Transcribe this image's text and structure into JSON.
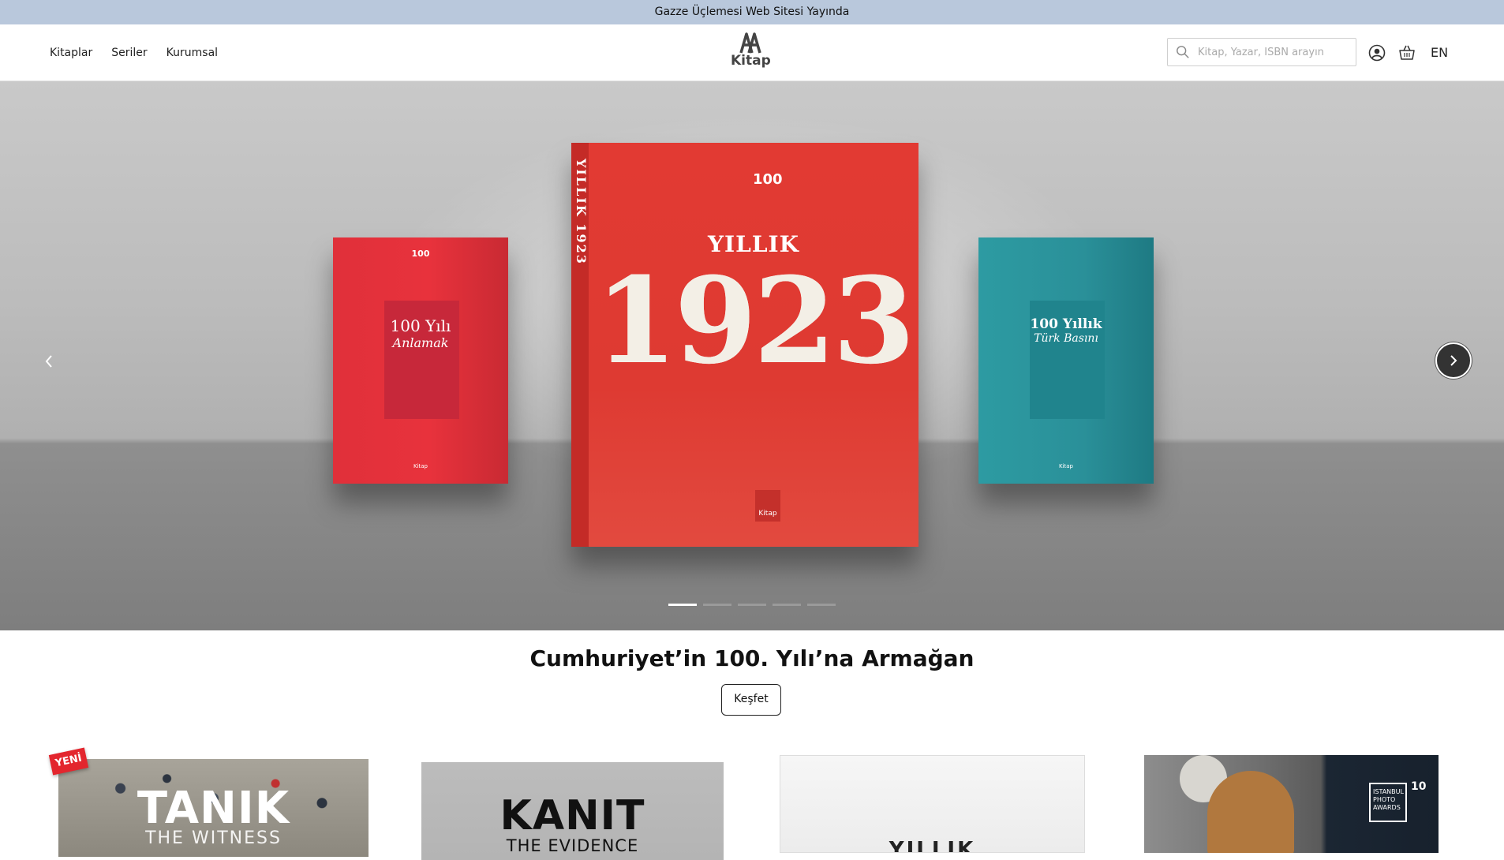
{
  "announcement": "Gazze Üçlemesi Web Sitesi Yayında",
  "nav": {
    "items": [
      "Kitaplar",
      "Seriler",
      "Kurumsal"
    ]
  },
  "logo": {
    "text": "Kitap"
  },
  "search": {
    "placeholder": "Kitap, Yazar, ISBN arayın"
  },
  "header": {
    "lang": "EN"
  },
  "hero": {
    "main_book": {
      "spine": "YILLIK 1923",
      "title": "YILLIK",
      "year": "1923",
      "badge": "100",
      "emblem": "Kitap"
    },
    "left_book": {
      "line1": "100 Yılı",
      "line2": "Anlamak",
      "badge": "100",
      "logo": "Kitap"
    },
    "right_book": {
      "line1": "100 Yıllık",
      "line2": "Türk Basını",
      "logo": "Kitap"
    },
    "slide_count": 5,
    "active_slide": 1
  },
  "feature": {
    "title": "Cumhuriyet’in 100. Yılı’na Armağan",
    "button": "Keşfet"
  },
  "cards": [
    {
      "badge": "YENİ",
      "title": "TANIK",
      "subtitle": "THE WITNESS"
    },
    {
      "title": "KANIT",
      "subtitle": "THE EVIDENCE"
    },
    {
      "title": "YILLIK"
    },
    {
      "award_text": "ISTANBUL PHOTO AWARDS",
      "award_number": "10"
    }
  ],
  "colors": {
    "topbar": "#b9c8dc",
    "accent_red": "#e3262e",
    "teal": "#2a9099"
  }
}
